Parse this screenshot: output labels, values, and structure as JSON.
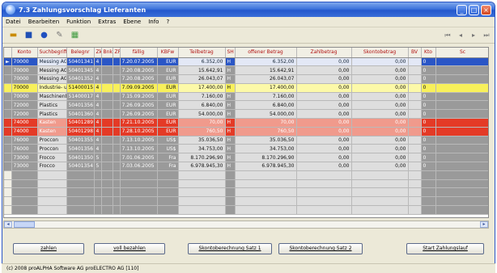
{
  "window": {
    "title": "7.3 Zahlungsvorschlag Lieferanten"
  },
  "menu": [
    "Datei",
    "Bearbeiten",
    "Funktion",
    "Extras",
    "Ebene",
    "Info",
    "?"
  ],
  "table": {
    "columns": [
      "Konto",
      "Suchbegriff",
      "Belegnr",
      "Zk",
      "BnkV",
      "ZF",
      "fällig",
      "KBFw",
      "Teilbetrag",
      "SH",
      "offener Betrag",
      "Zahlbetrag",
      "Skontobetrag",
      "BV",
      "Kto",
      "Sc"
    ],
    "rows": [
      {
        "style": "blue",
        "marker": "►",
        "cells": [
          "70000",
          "Messing AG",
          "50401341",
          "4",
          "",
          "",
          "7.20.07.2005",
          "EUR",
          "6.352,00",
          "H",
          "6.352,00",
          "0,00",
          "0,00",
          "",
          "0",
          ""
        ]
      },
      {
        "style": "grey",
        "marker": "",
        "cells": [
          "70000",
          "Messing AG",
          "50401345",
          "4",
          "",
          "",
          "7.20.08.2005",
          "EUR",
          "15.642,91",
          "H",
          "15.642,91",
          "0,00",
          "0,00",
          "",
          "0",
          ""
        ]
      },
      {
        "style": "grey",
        "marker": "",
        "cells": [
          "70000",
          "Messing AG",
          "50401352",
          "4",
          "",
          "",
          "7.20.08.2005",
          "EUR",
          "26.043,07",
          "H",
          "26.043,07",
          "0,00",
          "0,00",
          "",
          "0",
          ""
        ]
      },
      {
        "style": "yellow",
        "marker": "",
        "cells": [
          "70000",
          "Industrie- u.",
          "51400015",
          "4",
          "",
          "",
          "7.09.09.2005",
          "EUR",
          "17.400,00",
          "H",
          "17.400,00",
          "0,00",
          "0,00",
          "",
          "0",
          ""
        ]
      },
      {
        "style": "grey",
        "marker": "",
        "cells": [
          "70000",
          "Maschinenb.",
          "51400017",
          "4",
          "",
          "",
          "7.15.09.2005",
          "EUR",
          "7.160,00",
          "H",
          "7.160,00",
          "0,00",
          "0,00",
          "",
          "0",
          ""
        ]
      },
      {
        "style": "grey",
        "marker": "",
        "cells": [
          "72000",
          "Plastics",
          "50401356",
          "4",
          "",
          "",
          "7.26.09.2005",
          "EUR",
          "6.840,00",
          "H",
          "6.840,00",
          "0,00",
          "0,00",
          "",
          "0",
          ""
        ]
      },
      {
        "style": "grey",
        "marker": "",
        "cells": [
          "72000",
          "Plastics",
          "50401360",
          "4",
          "",
          "",
          "7.26.09.2005",
          "EUR",
          "54.000,00",
          "H",
          "54.000,00",
          "0,00",
          "0,00",
          "",
          "0",
          ""
        ]
      },
      {
        "style": "red",
        "marker": "",
        "cells": [
          "74000",
          "Kasten",
          "50401289",
          "4",
          "",
          "",
          "7.21.10.2005",
          "EUR",
          "70,00",
          "H",
          "70,00",
          "0,00",
          "0,00",
          "",
          "0",
          ""
        ]
      },
      {
        "style": "red",
        "marker": "",
        "cells": [
          "74000",
          "Kasten",
          "50401298",
          "4",
          "",
          "",
          "7.28.10.2005",
          "EUR",
          "760,50",
          "H",
          "760,50",
          "0,00",
          "0,00",
          "",
          "0",
          ""
        ]
      },
      {
        "style": "grey",
        "marker": "",
        "cells": [
          "76000",
          "Proccon",
          "50401355",
          "4",
          "",
          "",
          "7.13.10.2005",
          "US$",
          "35.036,50",
          "H",
          "35.036,50",
          "0,00",
          "0,00",
          "",
          "0",
          ""
        ]
      },
      {
        "style": "grey",
        "marker": "",
        "cells": [
          "76000",
          "Proccon",
          "50401356",
          "4",
          "",
          "",
          "7.13.10.2005",
          "US$",
          "34.753,00",
          "H",
          "34.753,00",
          "0,00",
          "0,00",
          "",
          "0",
          ""
        ]
      },
      {
        "style": "grey",
        "marker": "",
        "cells": [
          "73000",
          "Frocco",
          "50401350",
          "5",
          "",
          "",
          "7.01.06.2005",
          "Fra",
          "8.170.296,90",
          "H",
          "8.170.296,90",
          "0,00",
          "0,00",
          "",
          "0",
          ""
        ]
      },
      {
        "style": "grey",
        "marker": "",
        "cells": [
          "73000",
          "Frocco",
          "50401354",
          "5",
          "",
          "",
          "7.03.06.2005",
          "Fra",
          "6.978.945,30",
          "H",
          "6.978.945,30",
          "0,00",
          "0,00",
          "",
          "0",
          ""
        ]
      },
      {
        "style": "empty",
        "marker": "",
        "cells": [
          "",
          "",
          "",
          "",
          "",
          "",
          "",
          "",
          "",
          "",
          "",
          "",
          "",
          "",
          "",
          ""
        ]
      },
      {
        "style": "empty",
        "marker": "",
        "cells": [
          "",
          "",
          "",
          "",
          "",
          "",
          "",
          "",
          "",
          "",
          "",
          "",
          "",
          "",
          "",
          ""
        ]
      },
      {
        "style": "empty",
        "marker": "",
        "cells": [
          "",
          "",
          "",
          "",
          "",
          "",
          "",
          "",
          "",
          "",
          "",
          "",
          "",
          "",
          "",
          ""
        ]
      },
      {
        "style": "empty",
        "marker": "",
        "cells": [
          "",
          "",
          "",
          "",
          "",
          "",
          "",
          "",
          "",
          "",
          "",
          "",
          "",
          "",
          "",
          ""
        ]
      },
      {
        "style": "empty",
        "marker": "",
        "cells": [
          "",
          "",
          "",
          "",
          "",
          "",
          "",
          "",
          "",
          "",
          "",
          "",
          "",
          "",
          "",
          ""
        ]
      }
    ]
  },
  "buttons": {
    "pay": "zahlen",
    "pay_all": "voll bezahlen",
    "discount1": "Skontoberechnung Satz 1",
    "discount2": "Skontoberechnung Satz 2",
    "start": "Start Zahlungslauf"
  },
  "status": {
    "text": "(c) 2008 proALPHA Software AG  proELECTRO AG [110]"
  },
  "colors": {
    "title": "#2357cc",
    "selected_row": "#2a56c6",
    "yellow_row": "#f8f05a",
    "red_row": "#e43a26",
    "grey_row": "#9a9a9a"
  },
  "icons": [
    "open-folder-icon",
    "save-icon",
    "stop-icon",
    "wrench-icon",
    "calculator-icon",
    "first-record-icon",
    "previous-record-icon",
    "next-record-icon",
    "last-record-icon"
  ]
}
